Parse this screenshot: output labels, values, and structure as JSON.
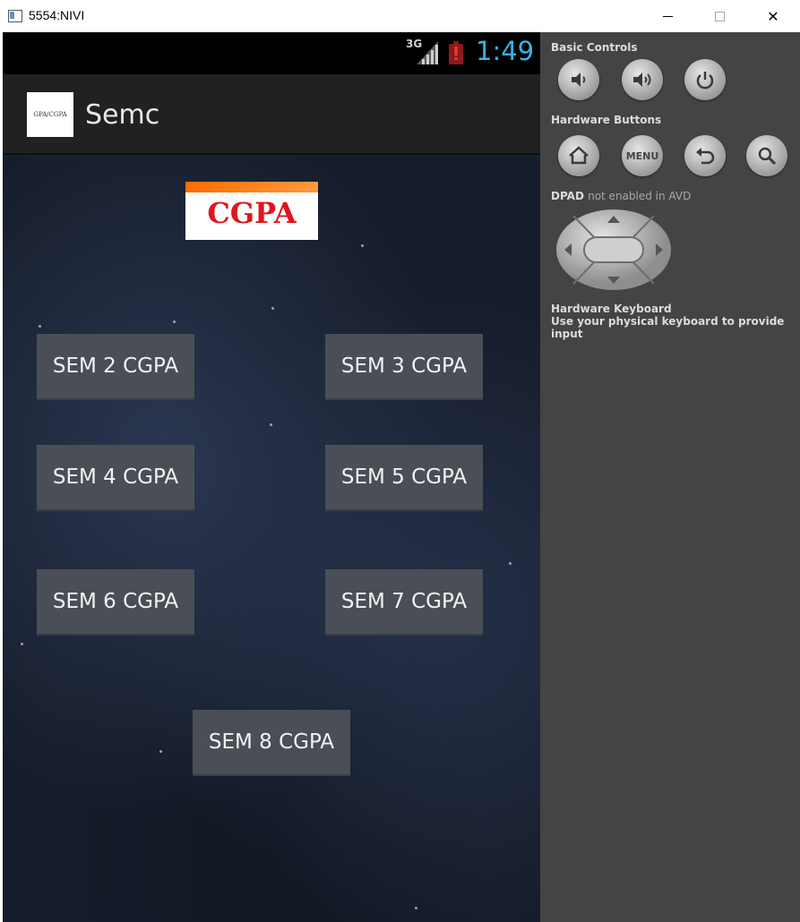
{
  "window": {
    "title": "5554:NIVI",
    "controls": [
      "minimize",
      "maximize",
      "close"
    ],
    "close_glyph": "✕"
  },
  "status_bar": {
    "network": "3G",
    "time": "1:49",
    "time_color": "#33b5e5"
  },
  "action_bar": {
    "logo_text": "GPA/CGPA",
    "title": "Semc"
  },
  "content": {
    "banner_text": "CGPA",
    "buttons": [
      "SEM 2 CGPA",
      "SEM 3 CGPA",
      "SEM 4 CGPA",
      "SEM 5 CGPA",
      "SEM 6 CGPA",
      "SEM 7 CGPA",
      "SEM 8 CGPA"
    ]
  },
  "side_panel": {
    "basic_controls": "Basic Controls",
    "hardware_buttons": "Hardware Buttons",
    "dpad_label": "DPAD",
    "dpad_note": "not enabled in AVD",
    "keyboard_title": "Hardware Keyboard",
    "keyboard_note": "Use your physical keyboard to provide input",
    "menu_label": "MENU",
    "icons": {
      "basic": [
        "volume-down-icon",
        "volume-up-icon",
        "power-icon"
      ],
      "hardware": [
        "home-icon",
        "menu-icon",
        "back-icon",
        "search-icon"
      ]
    }
  }
}
